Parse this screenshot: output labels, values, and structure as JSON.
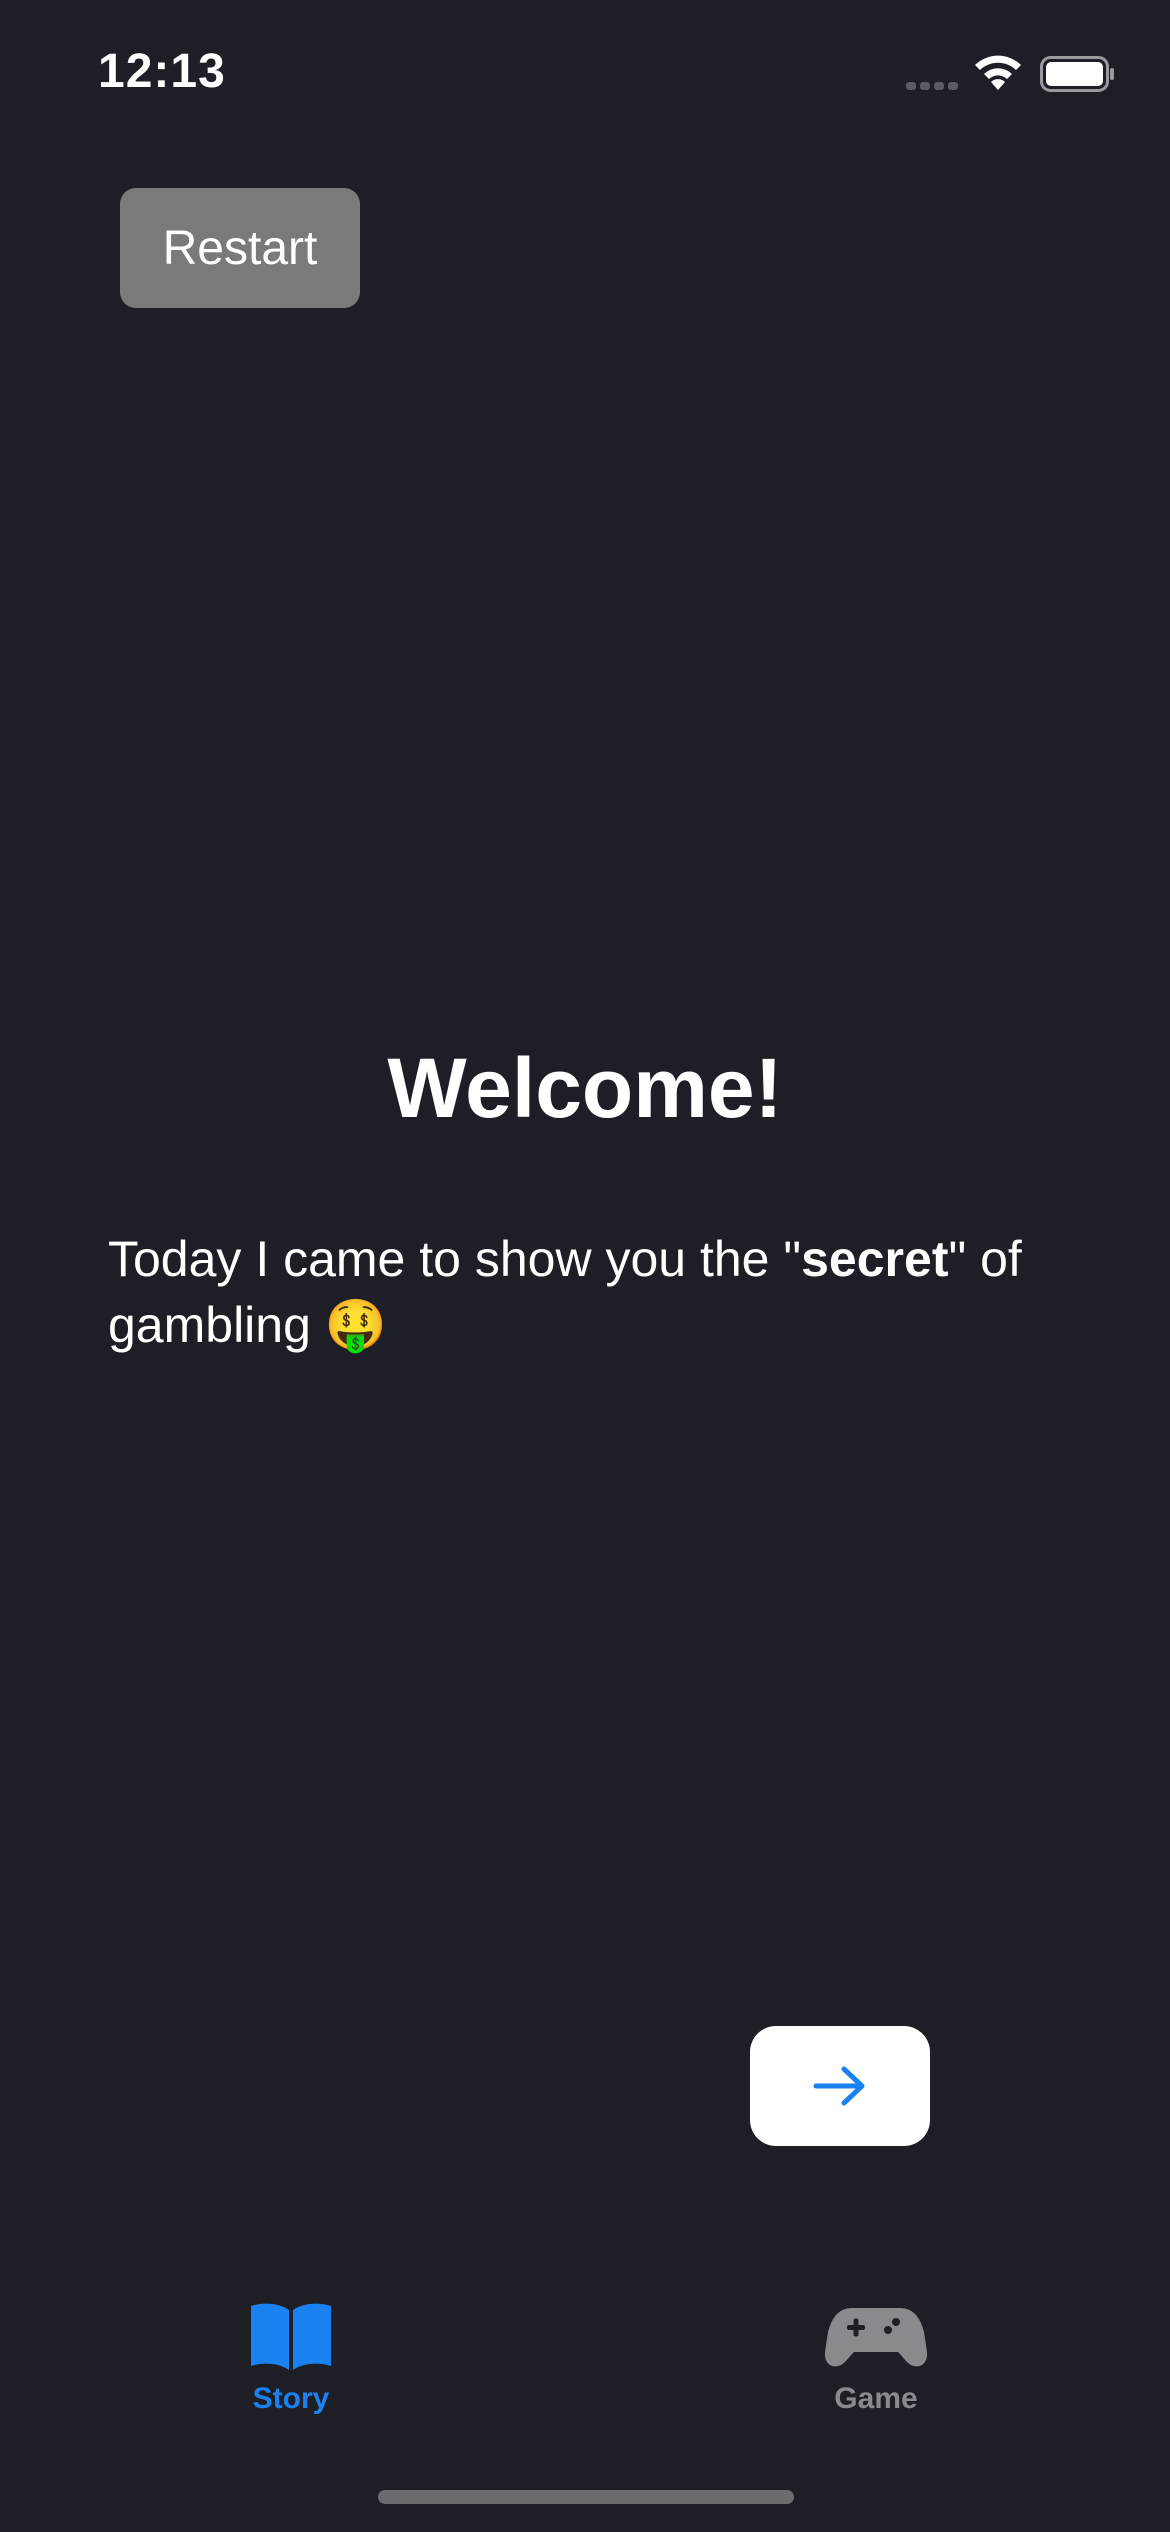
{
  "status_bar": {
    "time": "12:13"
  },
  "header": {
    "restart_label": "Restart"
  },
  "main": {
    "title": "Welcome!",
    "intro_prefix": "Today I came to show you the \"",
    "intro_bold": "secret",
    "intro_suffix": "\" of gambling",
    "intro_emoji": "🤑"
  },
  "next_button": {
    "icon": "arrow-right-icon"
  },
  "tab_bar": {
    "tabs": [
      {
        "label": "Story",
        "icon": "book-icon",
        "selected": true
      },
      {
        "label": "Game",
        "icon": "gamecontroller-icon",
        "selected": false
      }
    ]
  },
  "colors": {
    "background": "#1e1e26",
    "accent": "#1a82f0",
    "restart_button": "#7a7a7a",
    "tab_inactive": "#8a8a8e"
  }
}
